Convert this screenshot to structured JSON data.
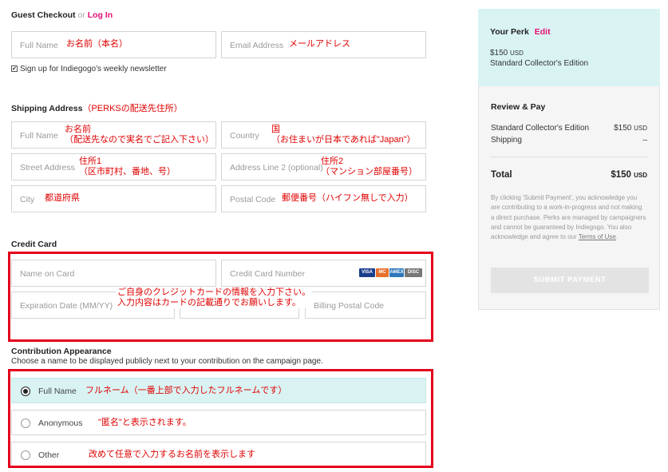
{
  "guest": {
    "title": "Guest Checkout",
    "or": "or",
    "login": "Log In",
    "fullname_ph": "Full Name",
    "fullname_note": "お名前（本名）",
    "email_ph": "Email Address",
    "email_note": "メールアドレス",
    "newsletter_check": "✔",
    "newsletter": "Sign up for Indiegogo's weekly newsletter"
  },
  "shipping": {
    "title": "Shipping Address",
    "title_note": "（PERKSの配送先住所）",
    "fullname_ph": "Full Name",
    "fullname_note1": "お名前",
    "fullname_note2": "（配送先なので実名でご記入下さい）",
    "country_ph": "Country",
    "country_note1": "国",
    "country_note2": "（お住まいが日本であれば\"Japan\"）",
    "street_ph": "Street Address",
    "street_note1": "住所1",
    "street_note2": "（区市町村、番地、号）",
    "line2_ph": "Address Line 2 (optional)",
    "line2_note1": "住所2",
    "line2_note2": "（マンション部屋番号）",
    "city_ph": "City",
    "city_note": "都道府県",
    "postal_ph": "Postal Code",
    "postal_note": "郵便番号（ハイフン無しで入力）"
  },
  "credit": {
    "title": "Credit Card",
    "name_ph": "Name on Card",
    "number_ph": "Credit Card Number",
    "expiry_ph": "Expiration Date (MM/YY)",
    "billing_ph": "Billing Postal Code",
    "note1": "ご自身のクレジットカードの情報を入力下さい。",
    "note2": "入力内容はカードの記載通りでお願いします。",
    "card_logos": [
      "VISA",
      "MC",
      "AMEX",
      "DISC"
    ],
    "card_colors": [
      "#1a3e8c",
      "#e8702a",
      "#2e77bb",
      "#777777"
    ]
  },
  "appearance": {
    "title": "Contribution Appearance",
    "subtitle": "Choose a name to be displayed publicly next to your contribution on the campaign page.",
    "options": [
      {
        "label": "Full Name",
        "note": "フルネーム（一番上部で入力したフルネームです）",
        "selected": true
      },
      {
        "label": "Anonymous",
        "note": "\"匿名\"と表示されます。",
        "selected": false
      },
      {
        "label": "Other",
        "note": "改めて任意で入力するお名前を表示します",
        "selected": false
      }
    ]
  },
  "perk": {
    "title": "Your Perk",
    "edit": "Edit",
    "price": "$150",
    "currency": "USD",
    "name": "Standard Collector's Edition"
  },
  "review": {
    "title": "Review & Pay",
    "item": "Standard Collector's Edition",
    "item_price": "$150",
    "item_currency": "USD",
    "shipping": "Shipping",
    "shipping_value": "–",
    "total": "Total",
    "total_price": "$150",
    "total_currency": "USD",
    "legal": "By clicking 'Submit Payment', you acknowledge you are contributing to a work-in-progress and not making a direct purchase. Perks are managed by campaigners and cannot be guaranteed by Indiegogo. You also acknowledge and agree to our",
    "terms": "Terms of Use",
    "submit": "SUBMIT PAYMENT"
  },
  "colors": {
    "accent": "#e51075",
    "annotation": "#e00000",
    "perk_bg": "#d9f3f3",
    "submit_bg": "#e3e3e3"
  }
}
